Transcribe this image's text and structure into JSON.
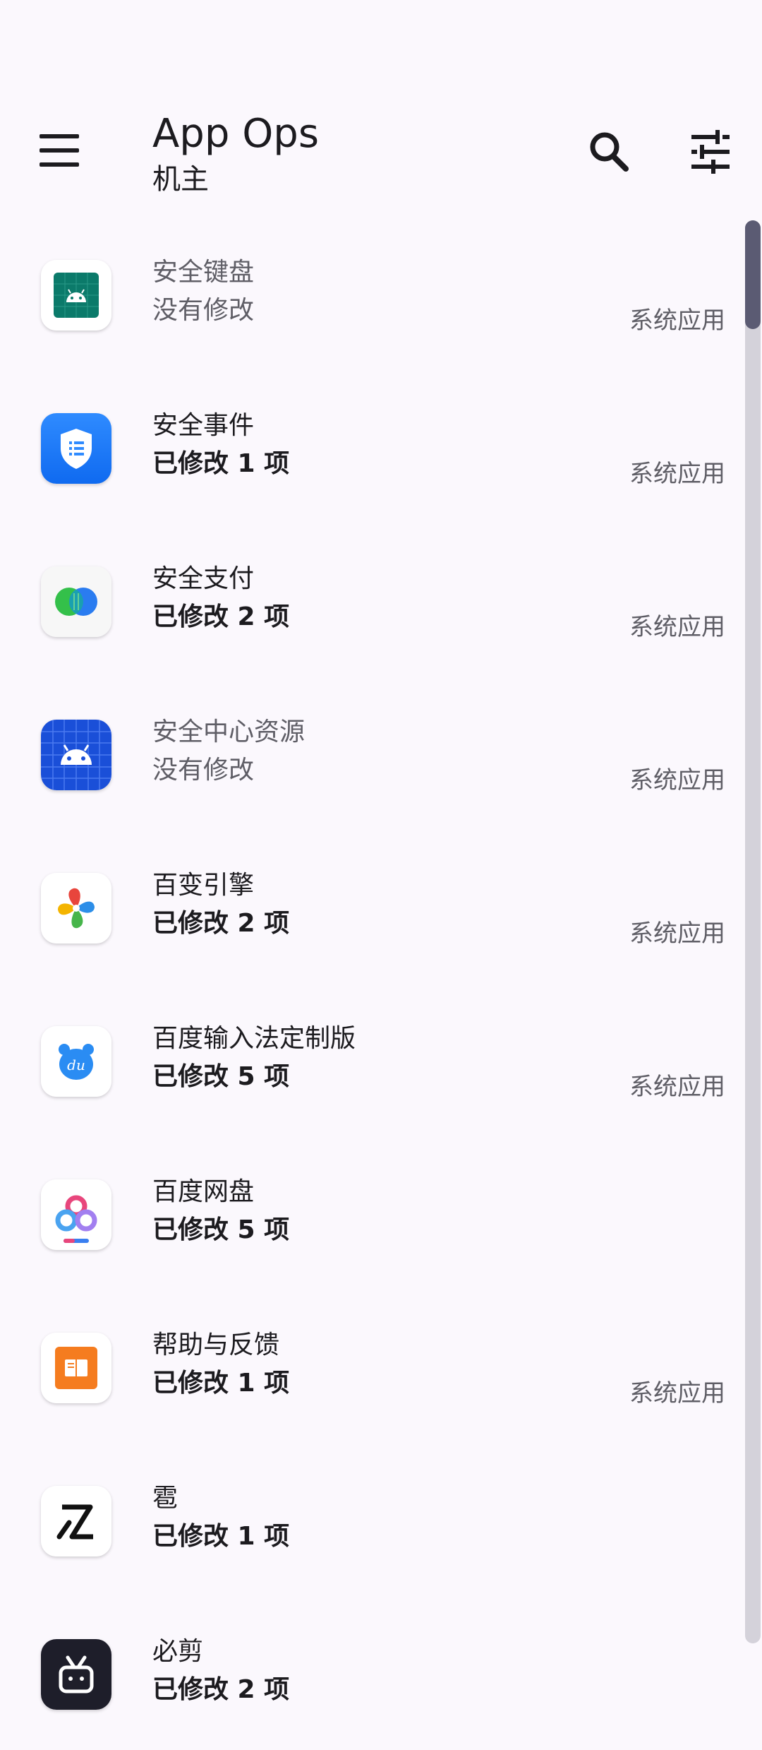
{
  "app_bar": {
    "title": "App Ops",
    "subtitle": "机主",
    "icons": {
      "menu": "menu-icon",
      "search": "search-icon",
      "filter": "tune-icon"
    }
  },
  "apps": [
    {
      "name": "安全键盘",
      "status": "没有修改",
      "tag": "系统应用",
      "icon": "android-teal-icon"
    },
    {
      "name": "安全事件",
      "status": "已修改 1 项",
      "tag": "系统应用",
      "icon": "security-shield-icon"
    },
    {
      "name": "安全支付",
      "status": "已修改 2 项",
      "tag": "系统应用",
      "icon": "safe-pay-icon"
    },
    {
      "name": "安全中心资源",
      "status": "没有修改",
      "tag": "系统应用",
      "icon": "android-blue-icon"
    },
    {
      "name": "百变引擎",
      "status": "已修改 2 项",
      "tag": "系统应用",
      "icon": "pinwheel-icon"
    },
    {
      "name": "百度输入法定制版",
      "status": "已修改 5 项",
      "tag": "系统应用",
      "icon": "baidu-input-icon"
    },
    {
      "name": "百度网盘",
      "status": "已修改 5 项",
      "tag": "",
      "icon": "baidu-netdisk-icon"
    },
    {
      "name": "帮助与反馈",
      "status": "已修改 1 项",
      "tag": "系统应用",
      "icon": "help-feedback-icon"
    },
    {
      "name": "雹",
      "status": "已修改 1 项",
      "tag": "",
      "icon": "bao-logo-icon"
    },
    {
      "name": "必剪",
      "status": "已修改 2 项",
      "tag": "",
      "icon": "bijian-tv-icon"
    }
  ],
  "colors": {
    "background": "#fbf8fd",
    "text": "#1c1b1f",
    "secondary_text": "#5f5e66",
    "scrollbar_thumb": "#5b5b73",
    "scrollbar_track": "#d4d2da"
  },
  "scroll_position": 0
}
